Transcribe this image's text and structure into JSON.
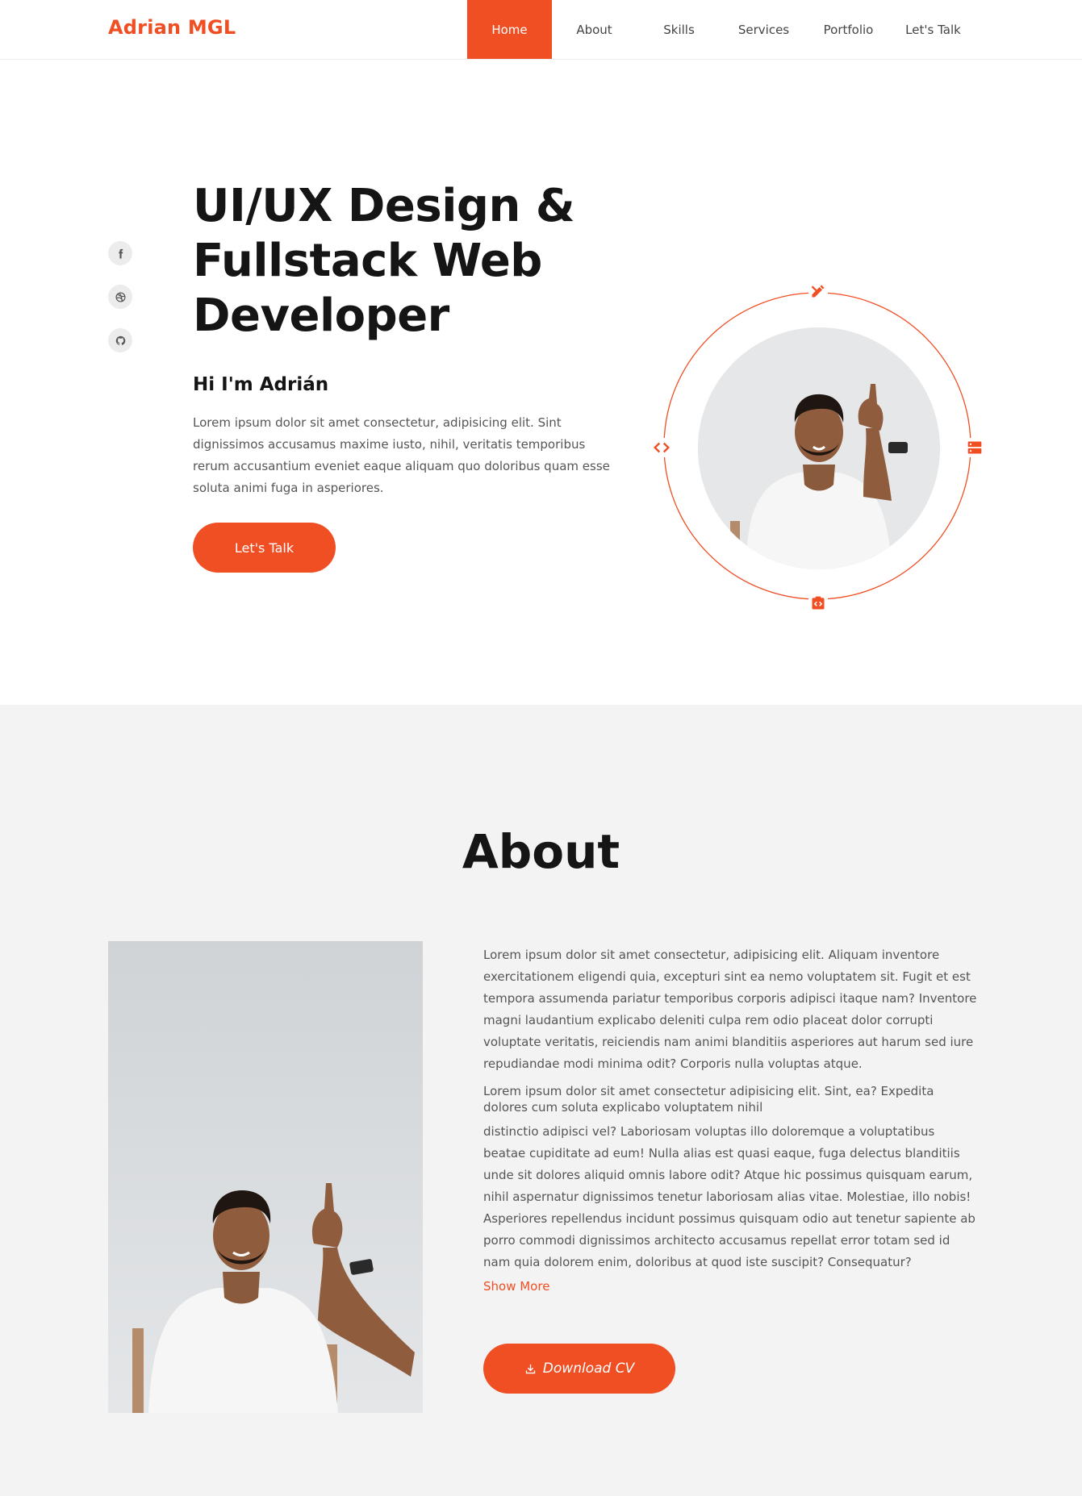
{
  "header": {
    "logo": "Adrian MGL",
    "nav": [
      {
        "label": "Home",
        "active": true
      },
      {
        "label": "About",
        "active": false
      },
      {
        "label": "Skills",
        "active": false
      },
      {
        "label": "Services",
        "active": false
      },
      {
        "label": "Portfolio",
        "active": false
      },
      {
        "label": "Let's Talk",
        "active": false
      }
    ]
  },
  "hero": {
    "social": [
      "facebook-icon",
      "dribbble-icon",
      "github-icon"
    ],
    "title_lines": [
      "UI/UX Design &",
      "Fullstack Web",
      "Developer"
    ],
    "subtitle": "Hi I'm Adrián",
    "description": "Lorem ipsum dolor sit amet consectetur, adipisicing elit. Sint dignissimos accusamus maxime iusto, nihil, veritatis temporibus rerum accusantium eveniet eaque aliquam quo doloribus quam esse soluta animi fuga in asperiores.",
    "cta_label": "Let's Talk",
    "orbit_icons": [
      "design-tools-icon",
      "server-icon",
      "code-file-icon",
      "code-brackets-icon"
    ]
  },
  "about": {
    "title": "About",
    "paragraph_1": "Lorem ipsum dolor sit amet consectetur, adipisicing elit. Aliquam inventore exercitationem eligendi quia, excepturi sint ea nemo voluptatem sit. Fugit et est tempora assumenda pariatur temporibus corporis adipisci itaque nam? Inventore magni laudantium explicabo deleniti culpa rem odio placeat dolor corrupti voluptate veritatis, reiciendis nam animi blanditiis asperiores aut harum sed iure repudiandae modi minima odit? Corporis nulla voluptas atque.",
    "paragraph_2": "Lorem ipsum dolor sit amet consectetur adipisicing elit. Sint, ea? Expedita dolores cum soluta explicabo voluptatem nihil",
    "paragraph_3": "distinctio adipisci vel? Laboriosam voluptas illo doloremque a voluptatibus beatae cupiditate ad eum! Nulla alias est quasi eaque, fuga delectus blanditiis unde sit dolores aliquid omnis labore odit? Atque hic possimus quisquam earum, nihil aspernatur dignissimos tenetur laboriosam alias vitae. Molestiae, illo nobis! Asperiores repellendus incidunt possimus quisquam odio aut tenetur sapiente ab porro commodi dignissimos architecto accusamus repellat error totam sed id nam quia dolorem enim, doloribus at quod iste suscipit? Consequatur?",
    "show_more": "Show More",
    "download_label": "Download CV"
  },
  "colors": {
    "accent": "#f04e23",
    "about_bg": "#f3f3f3",
    "text": "#151515",
    "muted": "#555555"
  }
}
